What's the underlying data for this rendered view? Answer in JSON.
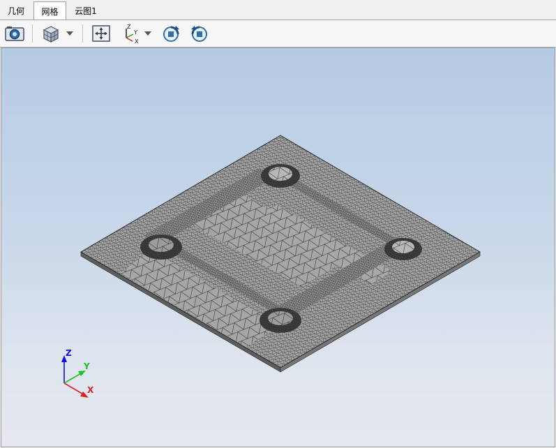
{
  "tabs": [
    {
      "label": "几何",
      "active": false
    },
    {
      "label": "网格",
      "active": true
    },
    {
      "label": "云图1",
      "active": false
    }
  ],
  "toolbar": {
    "icons": [
      "camera-icon",
      "view-cube-icon",
      "fit-view-icon",
      "axis-orientation-icon",
      "rotate-clockwise-icon",
      "rotate-counterclockwise-icon"
    ]
  },
  "triad": {
    "x_label": "X",
    "y_label": "Y",
    "z_label": "Z"
  },
  "colors": {
    "x_axis": "#e02020",
    "y_axis": "#20c020",
    "z_axis": "#1010e0",
    "mesh_fill": "#a3a3a3",
    "mesh_lines": "#1a1a1a",
    "background_top": "#b4cbe4",
    "background_bottom": "#e6e9ee"
  }
}
